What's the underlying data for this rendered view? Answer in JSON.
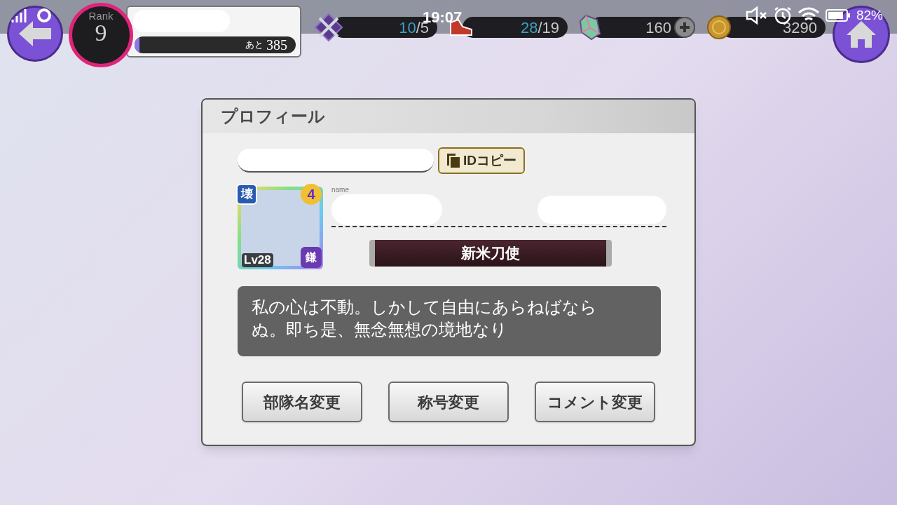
{
  "status_bar": {
    "time": "19:07",
    "battery": "82%"
  },
  "player": {
    "rank_label": "Rank",
    "rank": "9",
    "exp_prefix": "あと",
    "exp_remaining": "385",
    "level": 0.03
  },
  "resources": [
    {
      "kind": "battle",
      "current": "10",
      "max": "/5"
    },
    {
      "kind": "stamina",
      "current": "28",
      "max": "/19"
    },
    {
      "kind": "gem",
      "amount": "160"
    },
    {
      "kind": "coin",
      "amount": "3290"
    }
  ],
  "dialog": {
    "title": "プロフィール",
    "id_copy_button": "IDコピー",
    "name_label": "name",
    "card": {
      "attribute": "壊",
      "rarity": "4",
      "level": "Lv28",
      "weapon": "鎌"
    },
    "title_plate": "新米刀使",
    "comment": "私の心は不動。しかして自由にあらねばならぬ。即ち是、無念無想の境地なり",
    "buttons": [
      "部隊名変更",
      "称号変更",
      "コメント変更"
    ]
  }
}
